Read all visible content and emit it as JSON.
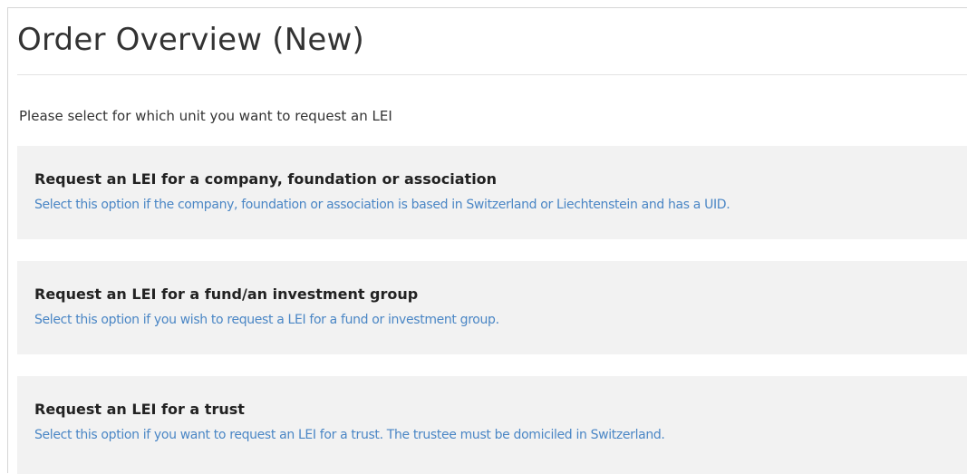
{
  "page": {
    "title": "Order Overview (New)",
    "intro": "Please select for which unit you want to request an LEI"
  },
  "options": [
    {
      "title": "Request an LEI for a company, foundation or association",
      "description": "Select this option if the company, foundation or association is based in Switzerland or Liechtenstein and has a UID."
    },
    {
      "title": "Request an LEI for a fund/an investment group",
      "description": "Select this option if you wish to request a LEI for a fund or investment group."
    },
    {
      "title": "Request an LEI for a trust",
      "description": "Select this option if you want to request an LEI for a trust. The trustee must be domiciled in Switzerland."
    }
  ],
  "colors": {
    "title_text": "#333333",
    "option_background": "#f2f2f2",
    "option_title": "#222222",
    "option_description": "#4a86c5",
    "divider": "#e3e3e3"
  }
}
